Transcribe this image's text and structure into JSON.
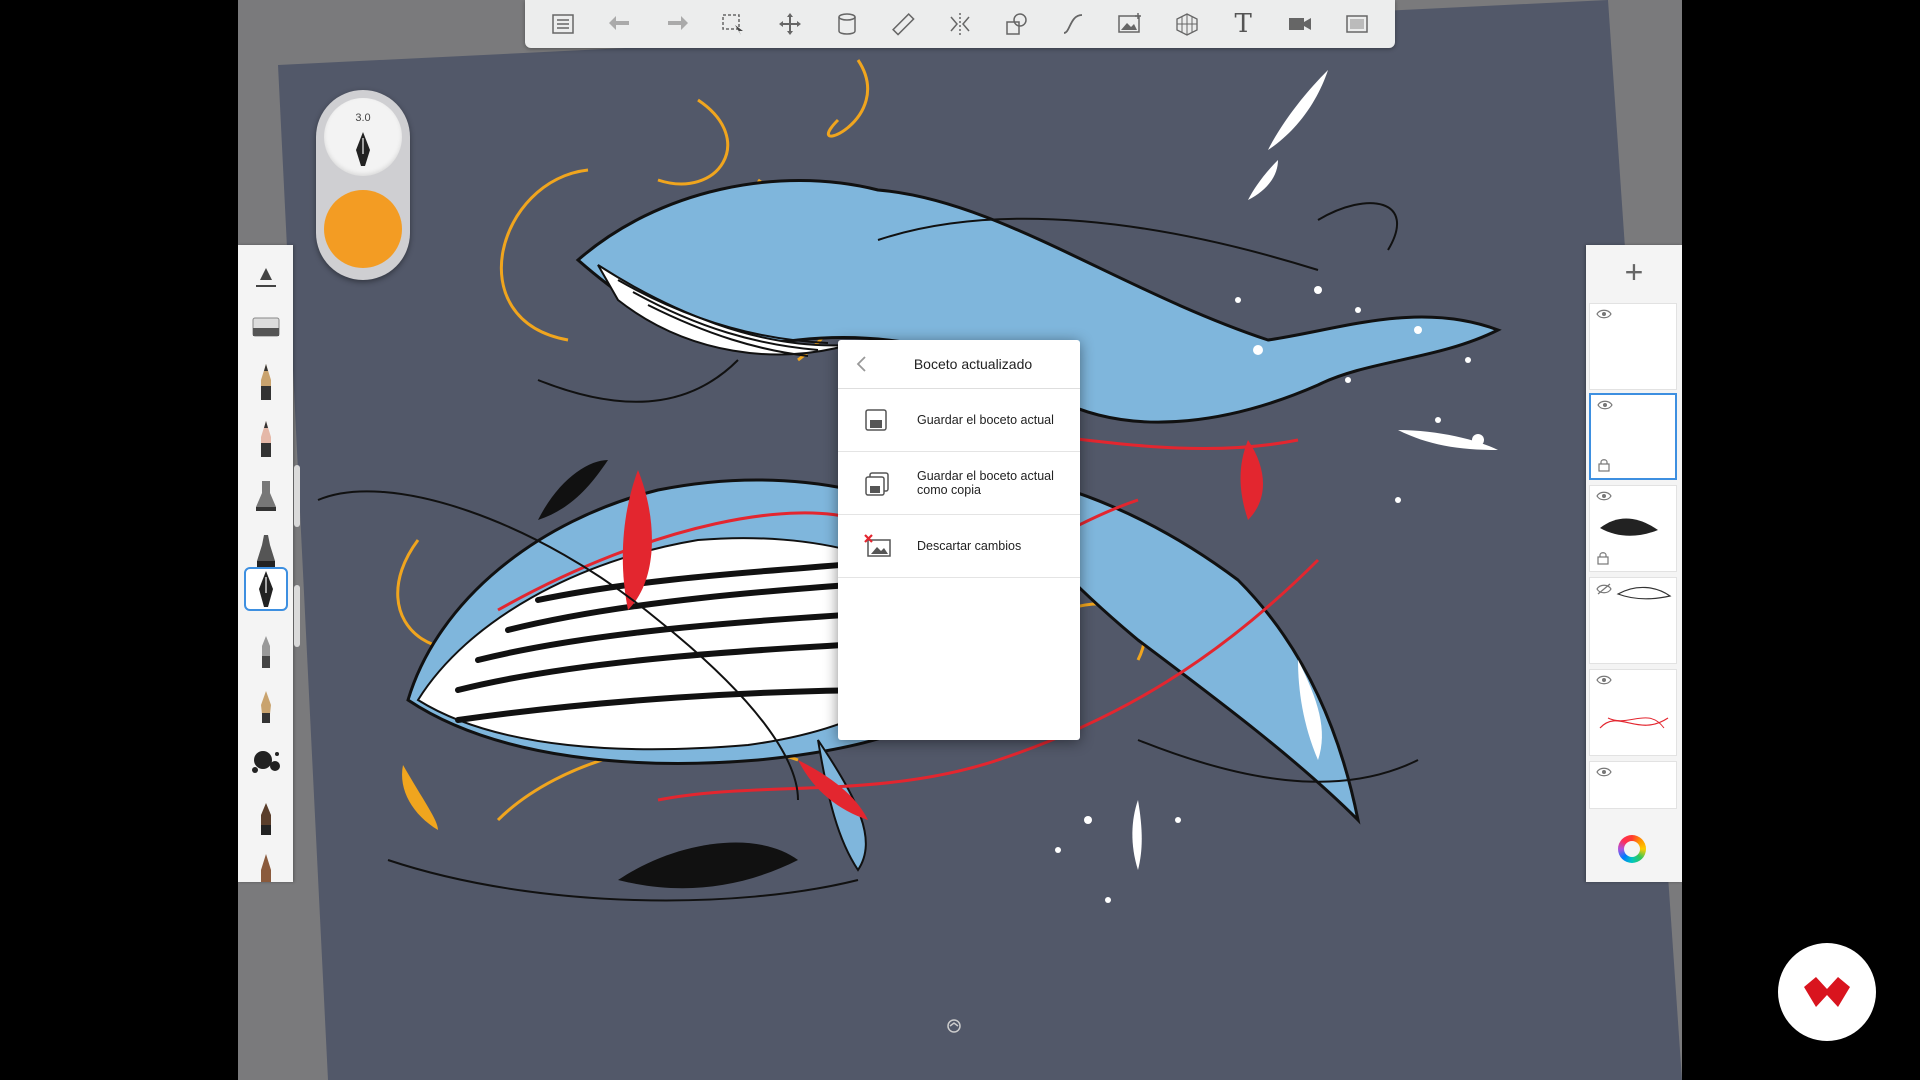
{
  "app": {
    "brush_size": "3.0",
    "current_color": "#f39c23"
  },
  "toolbar": {
    "tools": [
      {
        "name": "menu-icon",
        "icon": "list"
      },
      {
        "name": "undo-icon",
        "icon": "arrow-left"
      },
      {
        "name": "redo-icon",
        "icon": "arrow-right"
      },
      {
        "name": "selection-icon",
        "icon": "marquee"
      },
      {
        "name": "transform-icon",
        "icon": "move"
      },
      {
        "name": "fill-icon",
        "icon": "bucket"
      },
      {
        "name": "ruler-icon",
        "icon": "ruler"
      },
      {
        "name": "symmetry-icon",
        "icon": "symmetry"
      },
      {
        "name": "shapes-icon",
        "icon": "shapes"
      },
      {
        "name": "stroke-icon",
        "icon": "curve"
      },
      {
        "name": "image-icon",
        "icon": "image"
      },
      {
        "name": "perspective-icon",
        "icon": "grid"
      },
      {
        "name": "text-icon",
        "icon": "T"
      },
      {
        "name": "record-icon",
        "icon": "video"
      },
      {
        "name": "fullscreen-icon",
        "icon": "frame"
      }
    ],
    "text_tool_glyph": "T"
  },
  "palette": {
    "brushes": [
      "ruler-brush",
      "eraser",
      "pencil",
      "pencil-2",
      "airbrush",
      "marker",
      "ink-pen",
      "felt-pen",
      "fountain-pen",
      "splatter",
      "paintbrush",
      "chisel"
    ],
    "selected_index": 6
  },
  "popup": {
    "title": "Boceto actualizado",
    "items": [
      {
        "label": "Guardar el boceto actual",
        "icon": "save-icon"
      },
      {
        "label": "Guardar el boceto actual como copia",
        "icon": "save-copy-icon"
      },
      {
        "label": "Descartar cambios",
        "icon": "discard-icon"
      }
    ]
  },
  "layers": {
    "add_label": "+",
    "items": [
      {
        "visible": true,
        "locked": false,
        "selected": false
      },
      {
        "visible": true,
        "locked": true,
        "selected": true
      },
      {
        "visible": true,
        "locked": true,
        "selected": false
      },
      {
        "visible": false,
        "locked": false,
        "selected": false
      },
      {
        "visible": true,
        "locked": false,
        "selected": false
      },
      {
        "visible": true,
        "locked": false,
        "selected": false
      }
    ]
  },
  "colors": {
    "canvas_bg": "#525869",
    "whale_blue": "#7fb6dc",
    "accent_red": "#e3262f",
    "accent_orange": "#f0a51e",
    "selection_blue": "#3d8fe0"
  }
}
